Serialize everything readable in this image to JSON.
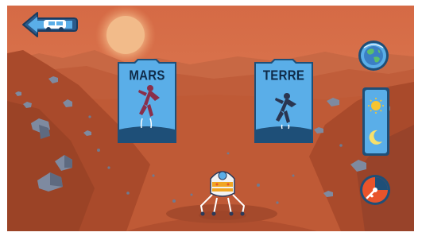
{
  "cards": {
    "mars": {
      "label": "MARS"
    },
    "earth": {
      "label": "TERRE"
    }
  },
  "icons": {
    "back": "back-arrow-rover-icon",
    "globe": "earth-globe-icon",
    "day": "sun-icon",
    "night": "moon-icon",
    "gravity": "drop-gauge-icon",
    "jumper": "jumping-figure-icon",
    "robot": "lander-robot-icon"
  },
  "colors": {
    "sky": "#d9673f",
    "ground": "#b5502f",
    "card": "#5aaee8",
    "card_dark": "#1e4f78",
    "accent_orange": "#e8542b"
  }
}
